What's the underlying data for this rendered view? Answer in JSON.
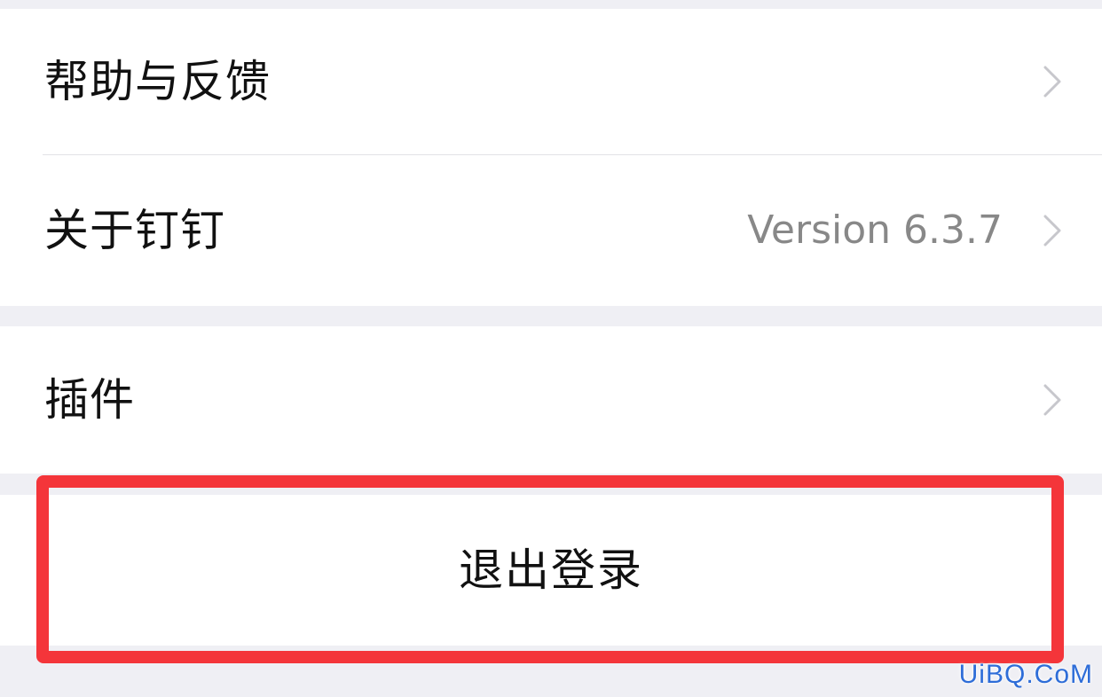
{
  "settings": {
    "help_feedback": {
      "label": "帮助与反馈",
      "icon": "chevron-right-icon"
    },
    "about": {
      "label": "关于钉钉",
      "value": "Version 6.3.7",
      "icon": "chevron-right-icon"
    },
    "plugins": {
      "label": "插件",
      "icon": "chevron-right-icon"
    },
    "logout": {
      "label": "退出登录"
    }
  },
  "annotation": {
    "highlight_color": "#f4353a"
  },
  "watermark": {
    "text": "UiBQ.CoM",
    "color": "#2e6dd8"
  },
  "colors": {
    "background": "#efeff4",
    "cell": "#ffffff",
    "text": "#111111",
    "secondary_text": "#888888",
    "chevron": "#c7c7cc"
  }
}
